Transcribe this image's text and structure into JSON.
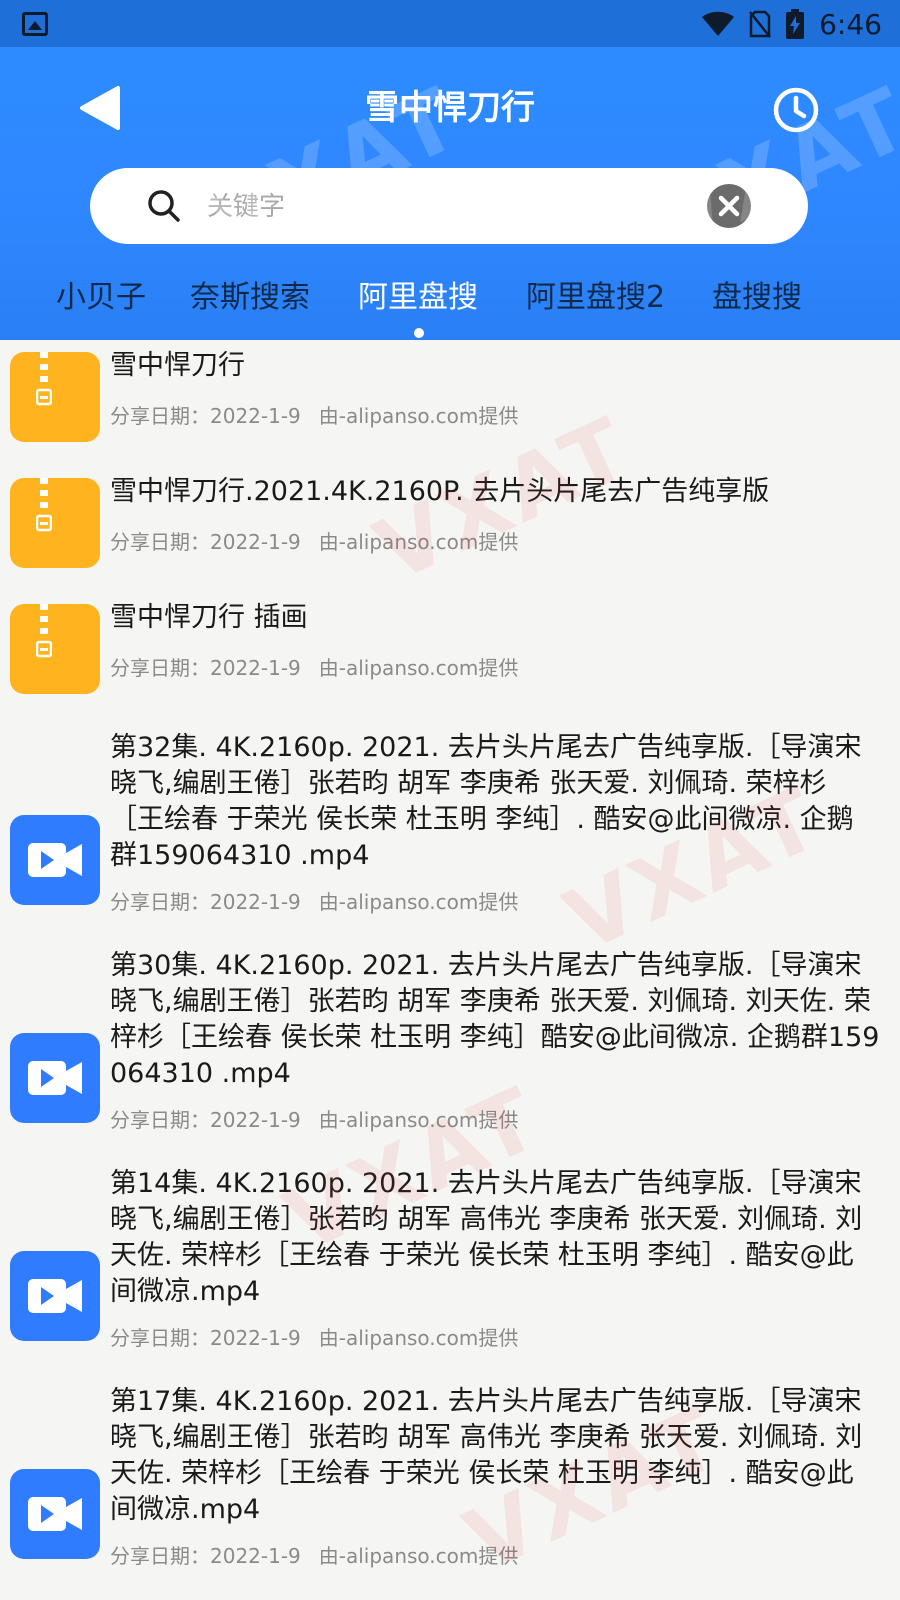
{
  "status_bar": {
    "time": "6:46",
    "icons": [
      "image-icon",
      "wifi-icon",
      "no-sim-icon",
      "battery-charging-icon"
    ]
  },
  "header": {
    "title": "雪中悍刀行",
    "back_icon": "back-arrow-icon",
    "history_icon": "clock-icon"
  },
  "search": {
    "value": "",
    "placeholder": "关键字"
  },
  "tabs": [
    {
      "label": "小贝子"
    },
    {
      "label": "奈斯搜索"
    },
    {
      "label": "阿里盘搜"
    },
    {
      "label": "阿里盘搜2"
    },
    {
      "label": "盘搜搜"
    }
  ],
  "active_tab": 2,
  "colors": {
    "header_blue": "#2e8cff",
    "zip_orange": "#ffb41f",
    "video_blue": "#2f7cff"
  },
  "results": [
    {
      "icon": "zip-icon",
      "title": "雪中悍刀行",
      "date_label": "分享日期：2022-1-9",
      "source": "由-alipanso.com提供"
    },
    {
      "icon": "zip-icon",
      "title": "雪中悍刀行.2021.4K.2160P. 去片头片尾去广告纯享版",
      "date_label": "分享日期：2022-1-9",
      "source": "由-alipanso.com提供"
    },
    {
      "icon": "zip-icon",
      "title": "雪中悍刀行 插画",
      "date_label": "分享日期：2022-1-9",
      "source": "由-alipanso.com提供"
    },
    {
      "icon": "video-icon",
      "title": "第32集. 4K.2160p. 2021. 去片头片尾去广告纯享版.［导演宋晓飞,编剧王倦］张若昀 胡军 李庚希 张天爱. 刘佩琦. 荣梓杉［王绘春 于荣光 侯长荣 杜玉明 李纯］. 酷安@此间微凉. 企鹅群159064310 .mp4",
      "date_label": "分享日期：2022-1-9",
      "source": "由-alipanso.com提供"
    },
    {
      "icon": "video-icon",
      "title": "第30集. 4K.2160p. 2021. 去片头片尾去广告纯享版.［导演宋晓飞,编剧王倦］张若昀 胡军 李庚希 张天爱. 刘佩琦. 刘天佐. 荣梓杉［王绘春 侯长荣 杜玉明 李纯］酷安@此间微凉. 企鹅群159064310 .mp4",
      "date_label": "分享日期：2022-1-9",
      "source": "由-alipanso.com提供"
    },
    {
      "icon": "video-icon",
      "title": "第14集. 4K.2160p. 2021. 去片头片尾去广告纯享版.［导演宋晓飞,编剧王倦］张若昀 胡军 高伟光 李庚希 张天爱. 刘佩琦. 刘天佐. 荣梓杉［王绘春 于荣光 侯长荣 杜玉明 李纯］. 酷安@此间微凉.mp4",
      "date_label": "分享日期：2022-1-9",
      "source": "由-alipanso.com提供"
    },
    {
      "icon": "video-icon",
      "title": "第17集. 4K.2160p. 2021. 去片头片尾去广告纯享版.［导演宋晓飞,编剧王倦］张若昀 胡军 高伟光 李庚希 张天爱. 刘佩琦. 刘天佐. 荣梓杉［王绘春 于荣光 侯长荣 杜玉明 李纯］. 酷安@此间微凉.mp4",
      "date_label": "分享日期：2022-1-9",
      "source": "由-alipanso.com提供"
    }
  ],
  "watermark": "VXAT"
}
